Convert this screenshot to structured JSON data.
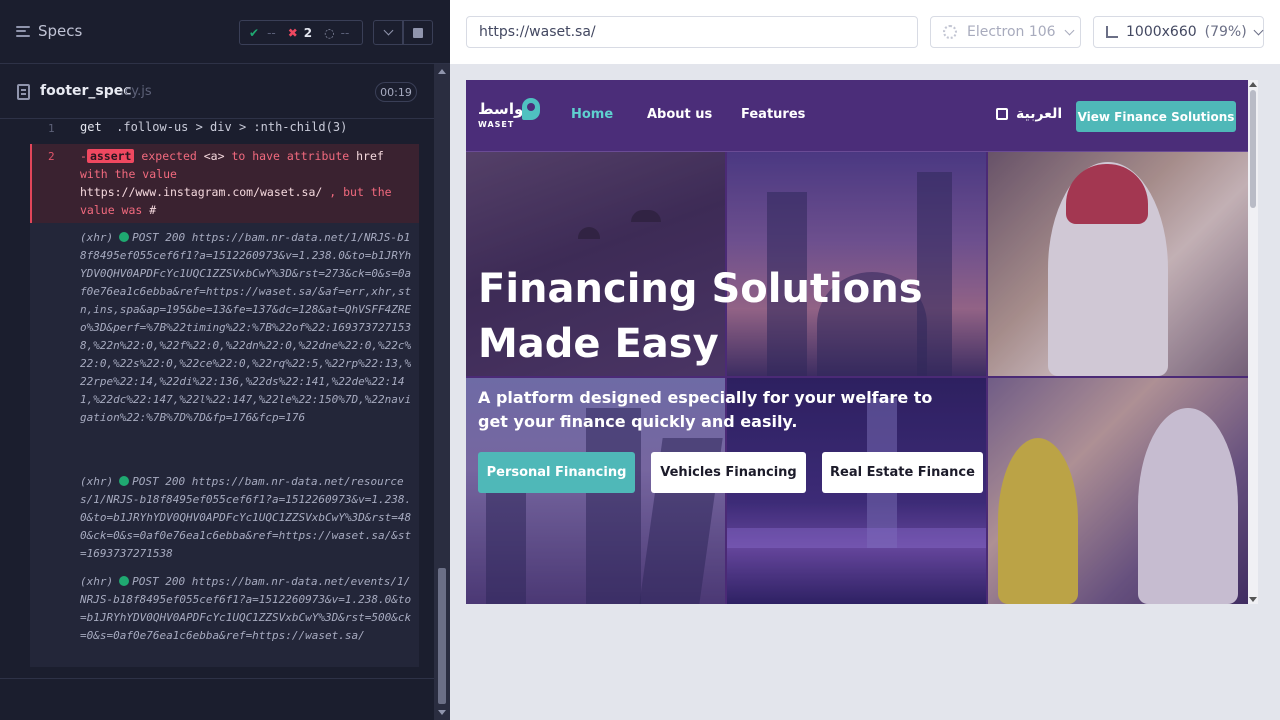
{
  "reporter": {
    "title": "Specs",
    "stats": {
      "passed": "--",
      "failed": "2",
      "pending": "--"
    },
    "file": {
      "name": "footer_spec",
      "ext": ".cy.js",
      "duration": "00:19"
    },
    "commands": [
      {
        "num": "1",
        "name": "get",
        "message": ".follow-us > div > :nth-child(3)"
      },
      {
        "num": "2",
        "prefix": "-",
        "badge": "assert",
        "t1": "expected",
        "t2": "<a>",
        "t3": "to have attribute",
        "t4": "href",
        "t5": "with the value",
        "t6": "https://www.instagram.com/waset.sa/",
        "t7": ", but the value was",
        "t8": "#"
      }
    ],
    "xhr": [
      {
        "label": "(xhr)",
        "method": "POST 200",
        "url": "https://bam.nr-data.net/1/NRJS-b18f8495ef055cef6f1?a=1512260973&v=1.238.0&to=b1JRYhYDV0QHV0APDFcYc1UQC1ZZSVxbCwY%3D&rst=273&ck=0&s=0af0e76ea1c6ebba&ref=https://waset.sa/&af=err,xhr,stn,ins,spa&ap=195&be=13&fe=137&dc=128&at=QhVSFF4ZREo%3D&perf=%7B%22timing%22:%7B%22of%22:1693737271538,%22n%22:0,%22f%22:0,%22dn%22:0,%22dne%22:0,%22c%22:0,%22s%22:0,%22ce%22:0,%22rq%22:5,%22rp%22:13,%22rpe%22:14,%22di%22:136,%22ds%22:141,%22de%22:141,%22dc%22:147,%22l%22:147,%22le%22:150%7D,%22navigation%22:%7B%7D%7D&fp=176&fcp=176"
      },
      {
        "label": "(xhr)",
        "method": "POST 200",
        "url": "https://bam.nr-data.net/resources/1/NRJS-b18f8495ef055cef6f1?a=1512260973&v=1.238.0&to=b1JRYhYDV0QHV0APDFcYc1UQC1ZZSVxbCwY%3D&rst=480&ck=0&s=0af0e76ea1c6ebba&ref=https://waset.sa/&st=1693737271538"
      },
      {
        "label": "(xhr)",
        "method": "POST 200",
        "url": "https://bam.nr-data.net/events/1/NRJS-b18f8495ef055cef6f1?a=1512260973&v=1.238.0&to=b1JRYhYDV0QHV0APDFcYc1UQC1ZZSVxbCwY%3D&rst=500&ck=0&s=0af0e76ea1c6ebba&ref=https://waset.sa/"
      }
    ]
  },
  "aut": {
    "url": "https://waset.sa/",
    "browser": "Electron 106",
    "viewport": "1000x660",
    "zoom": "(79%)"
  },
  "site": {
    "logo_ar": "واسط",
    "logo_en": "WASET",
    "nav": {
      "home": "Home",
      "about": "About us",
      "features": "Features"
    },
    "lang": "العربية",
    "cta": "View Finance Solutions",
    "hero": {
      "title_line1": "Financing Solutions",
      "title_line2": "Made Easy",
      "subtitle": "A platform designed especially for your welfare to get your finance quickly and easily.",
      "btn_personal": "Personal Financing",
      "btn_vehicles": "Vehicles Financing",
      "btn_realestate": "Real Estate Finance"
    }
  },
  "colors": {
    "accent_teal": "#4fb8b8",
    "brand_purple": "#4b2d79",
    "fail_red": "#f04860",
    "pass_green": "#1fa971"
  }
}
